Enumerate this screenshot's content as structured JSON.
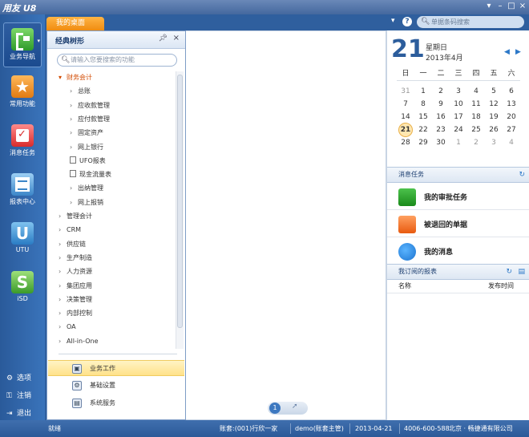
{
  "app": {
    "title": "用友 U8"
  },
  "nav": [
    {
      "label": "业务导航",
      "icon": "business-navigation-icon",
      "active": true
    },
    {
      "label": "常用功能",
      "icon": "star-icon",
      "active": false
    },
    {
      "label": "消息任务",
      "icon": "message-task-icon",
      "active": false
    },
    {
      "label": "报表中心",
      "icon": "report-center-icon",
      "active": false
    },
    {
      "label": "UTU",
      "icon": "utu-icon",
      "active": false
    },
    {
      "label": "iSD",
      "icon": "isd-icon",
      "active": false
    }
  ],
  "system": [
    {
      "label": "选项",
      "icon": "gear-icon"
    },
    {
      "label": "注销",
      "icon": "key-icon"
    },
    {
      "label": "退出",
      "icon": "exit-icon"
    }
  ],
  "tabs": {
    "home": "我的桌面"
  },
  "search": {
    "placeholder": "单据条码搜索"
  },
  "tree": {
    "title": "经典树形",
    "search_placeholder": "请输入您要搜索的功能",
    "nodes": [
      {
        "label": "财务会计",
        "level": 0,
        "type": "open"
      },
      {
        "label": "总账",
        "level": 1,
        "type": "closed"
      },
      {
        "label": "应收款管理",
        "level": 1,
        "type": "closed"
      },
      {
        "label": "应付款管理",
        "level": 1,
        "type": "closed"
      },
      {
        "label": "固定资产",
        "level": 1,
        "type": "closed"
      },
      {
        "label": "网上银行",
        "level": 1,
        "type": "closed"
      },
      {
        "label": "UFO报表",
        "level": 1,
        "type": "doc"
      },
      {
        "label": "现金流量表",
        "level": 1,
        "type": "doc"
      },
      {
        "label": "出纳管理",
        "level": 1,
        "type": "closed"
      },
      {
        "label": "网上报销",
        "level": 1,
        "type": "closed"
      },
      {
        "label": "管理会计",
        "level": 0,
        "type": "closed"
      },
      {
        "label": "CRM",
        "level": 0,
        "type": "closed"
      },
      {
        "label": "供应链",
        "level": 0,
        "type": "closed"
      },
      {
        "label": "生产制造",
        "level": 0,
        "type": "closed"
      },
      {
        "label": "人力资源",
        "level": 0,
        "type": "closed"
      },
      {
        "label": "集团应用",
        "level": 0,
        "type": "closed"
      },
      {
        "label": "决策管理",
        "level": 0,
        "type": "closed"
      },
      {
        "label": "内部控制",
        "level": 0,
        "type": "closed"
      },
      {
        "label": "OA",
        "level": 0,
        "type": "closed"
      },
      {
        "label": "All-in-One",
        "level": 0,
        "type": "closed"
      }
    ],
    "bottom": [
      {
        "label": "业务工作",
        "icon": "business-work-icon",
        "selected": true
      },
      {
        "label": "基础设置",
        "icon": "basic-settings-icon",
        "selected": false
      },
      {
        "label": "系统服务",
        "icon": "system-service-icon",
        "selected": false
      }
    ]
  },
  "workspace": {
    "page": "1"
  },
  "calendar": {
    "day": "21",
    "weekday": "星期日",
    "year_month": "2013年4月",
    "headers": [
      "日",
      "一",
      "二",
      "三",
      "四",
      "五",
      "六"
    ],
    "cells": [
      [
        "31",
        "1",
        "2",
        "3",
        "4",
        "5",
        "6"
      ],
      [
        "7",
        "8",
        "9",
        "10",
        "11",
        "12",
        "13"
      ],
      [
        "14",
        "15",
        "16",
        "17",
        "18",
        "19",
        "20"
      ],
      [
        "21",
        "22",
        "23",
        "24",
        "25",
        "26",
        "27"
      ],
      [
        "28",
        "29",
        "30",
        "1",
        "2",
        "3",
        "4"
      ]
    ],
    "today_row": 3,
    "today_col": 0
  },
  "messages": {
    "title": "消息任务",
    "items": [
      {
        "label": "我的审批任务",
        "icon": "approval-task-icon"
      },
      {
        "label": "被退回的单据",
        "icon": "returned-document-icon"
      },
      {
        "label": "我的消息",
        "icon": "my-message-icon"
      }
    ]
  },
  "reports": {
    "title": "我订阅的报表",
    "col_name": "名称",
    "col_time": "发布时间"
  },
  "status": {
    "ready": "就绪",
    "account": "账套:(001)行欣一家",
    "user": "demo(账套主管)",
    "date": "2013-04-21",
    "phone": "4006-600-588",
    "company": "北京 · 畅捷通有限公司"
  },
  "colors": {
    "accent": "#2f5f9e",
    "tab": "#f08c10",
    "calendar_day": "#2c5d9c"
  }
}
